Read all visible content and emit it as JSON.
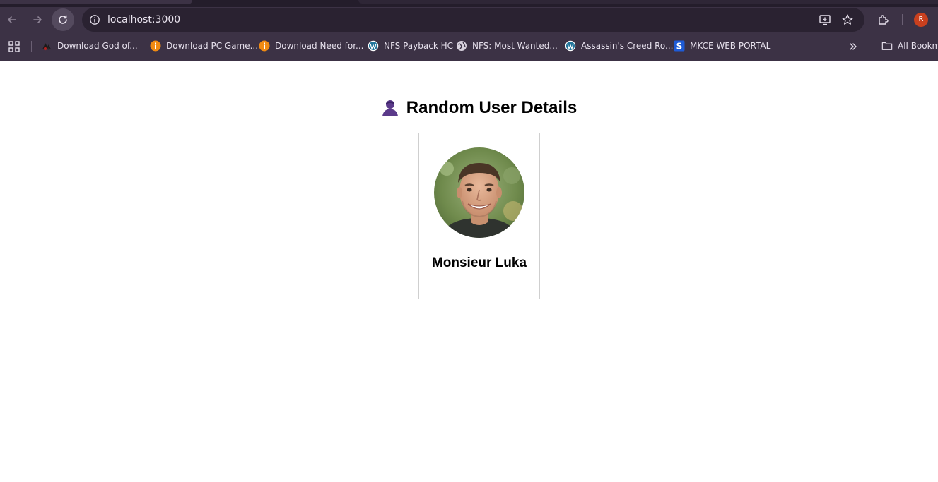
{
  "browser": {
    "url": "localhost:3000",
    "profile_initial": "R",
    "colors": {
      "frame": "#3c3245",
      "omnibox": "#2a2231",
      "profile": "#c9401e"
    }
  },
  "bookmarks": {
    "items": [
      {
        "label": "Download God of...",
        "icon": "game-favicon"
      },
      {
        "label": "Download PC Game...",
        "icon": "orange-info-favicon"
      },
      {
        "label": "Download Need for...",
        "icon": "orange-info-favicon"
      },
      {
        "label": "NFS Payback HC",
        "icon": "wordpress-favicon"
      },
      {
        "label": "NFS: Most Wanted...",
        "icon": "globe-favicon"
      },
      {
        "label": "Assassin's Creed Ro...",
        "icon": "wordpress-favicon"
      },
      {
        "label": "MKCE WEB PORTAL",
        "icon": "s-favicon"
      }
    ],
    "all_bookmarks_label": "All Bookmarks"
  },
  "page": {
    "heading": "Random User Details",
    "heading_icon": "user-silhouette-icon",
    "user": {
      "name": "Monsieur Luka",
      "photo": "profile-photo"
    }
  }
}
